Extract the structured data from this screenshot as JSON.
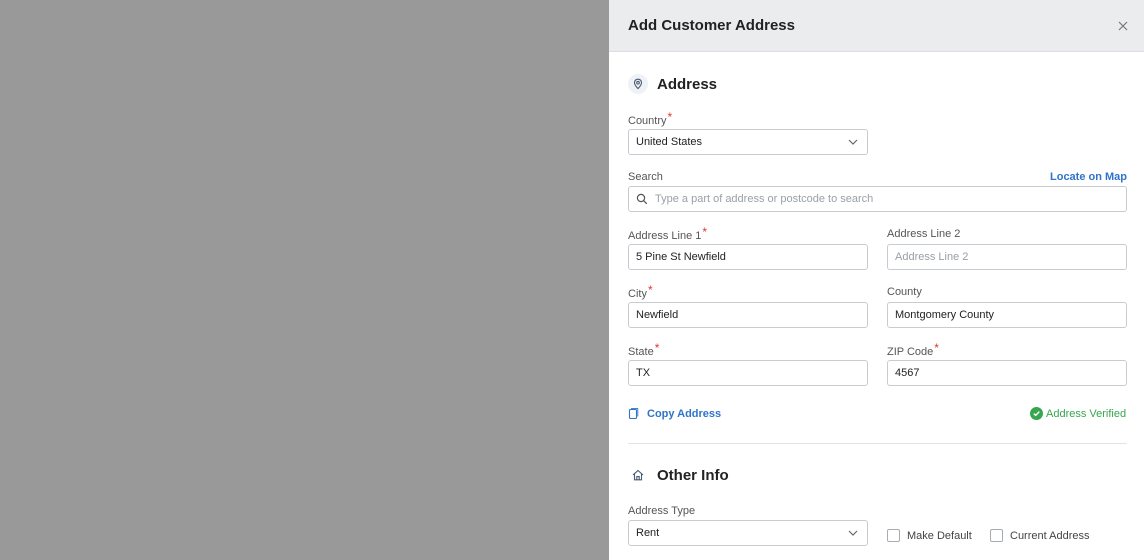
{
  "panel": {
    "title": "Add Customer Address"
  },
  "address_section": {
    "title": "Address",
    "icon": "map-pin-icon",
    "country": {
      "label": "Country",
      "value": "United States"
    },
    "search": {
      "label": "Search",
      "placeholder": "Type a part of address or postcode to search",
      "locate_link": "Locate on Map"
    },
    "address_line_1": {
      "label": "Address Line 1",
      "value": "5 Pine St Newfield"
    },
    "address_line_2": {
      "label": "Address Line 2",
      "placeholder": "Address Line 2"
    },
    "city": {
      "label": "City",
      "value": "Newfield"
    },
    "county": {
      "label": "County",
      "value": "Montgomery County"
    },
    "state": {
      "label": "State",
      "value": "TX"
    },
    "zip": {
      "label": "ZIP Code",
      "value": "4567"
    },
    "copy_link": "Copy Address",
    "verified_text": "Address Verified"
  },
  "other_section": {
    "title": "Other Info",
    "icon": "home-icon",
    "address_type": {
      "label": "Address Type",
      "value": "Rent"
    },
    "make_default": "Make Default",
    "current_address": "Current Address"
  },
  "colors": {
    "accent": "#2f74c9",
    "required": "#e0372b",
    "verified": "#36a64f",
    "overlay": "#999999",
    "header_bg": "#ebecee"
  }
}
